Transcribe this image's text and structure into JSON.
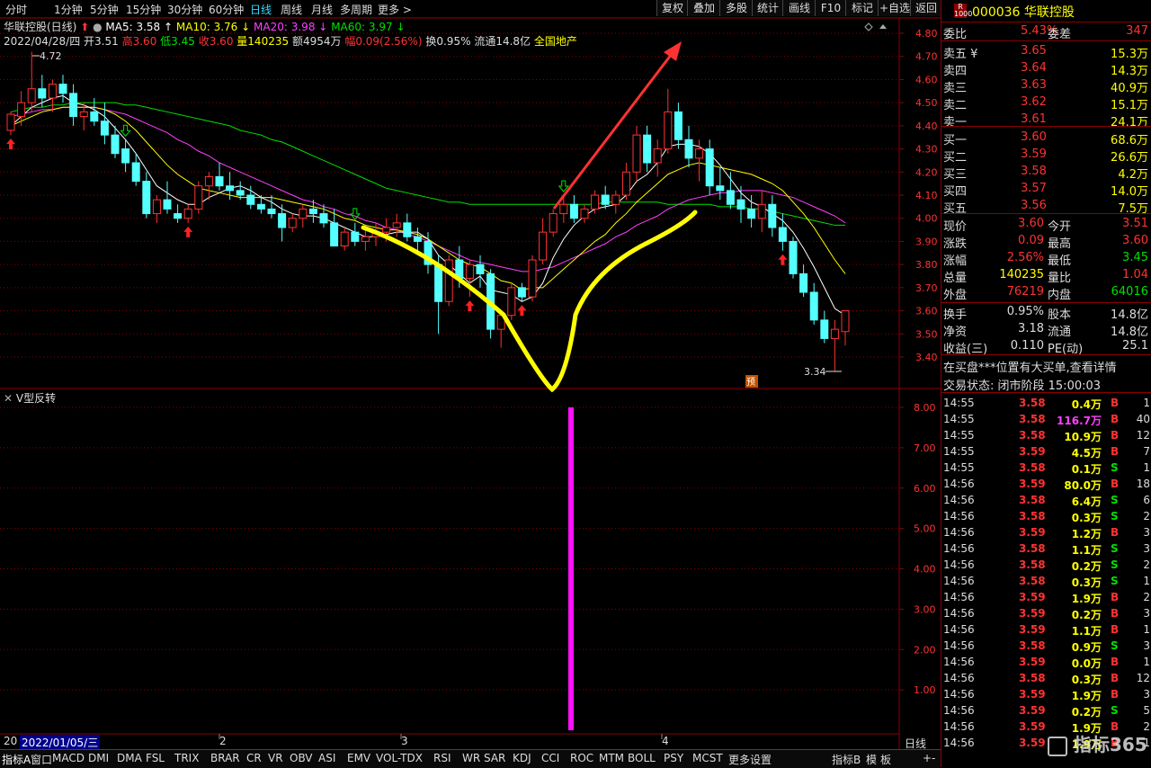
{
  "period_tabs": [
    "分时",
    "1分钟",
    "5分钟",
    "15分钟",
    "30分钟",
    "60分钟",
    "日线",
    "周线",
    "月线",
    "多周期",
    "更多 >"
  ],
  "active_tab": "日线",
  "toolbar_buttons": [
    "复权",
    "叠加",
    "多股",
    "统计",
    "画线",
    "F10",
    "标记",
    "+自选",
    "返回"
  ],
  "chart_header": {
    "name": "华联控股(日线)",
    "ma5": "MA5: 3.58",
    "ma10": "MA10: 3.76",
    "ma20": "MA20: 3.98",
    "ma60": "MA60: 3.97",
    "date": "2022/04/28/四",
    "open": "开3.51",
    "high": "高3.60",
    "low": "低3.45",
    "close": "收3.60",
    "volume": "量140235",
    "amount": "额4954万",
    "change": "幅0.09(2.56%)",
    "turnover": "换0.95%",
    "float": "流通14.8亿",
    "sector": "全国地产"
  },
  "price_axis": [
    "4.80",
    "4.70",
    "4.60",
    "4.50",
    "4.40",
    "4.30",
    "4.20",
    "4.10",
    "4.00",
    "3.90",
    "3.80",
    "3.70",
    "3.60",
    "3.50",
    "3.40"
  ],
  "price_high_label": "4.72",
  "price_low_label": "3.34",
  "yu_badge": "预",
  "indicator_title": "V型反转",
  "indicator_axis": [
    "8.00",
    "7.00",
    "6.00",
    "5.00",
    "4.00",
    "3.00",
    "2.00",
    "1.00"
  ],
  "x_axis": {
    "start": "20",
    "date_selected": "2022/01/05/三",
    "m2": "2",
    "m3": "3",
    "m4": "4"
  },
  "bottom_tabs": [
    "指标A",
    "窗口",
    "MACD",
    "DMI",
    "DMA",
    "FSL",
    "TRIX",
    "BRAR",
    "CR",
    "VR",
    "OBV",
    "ASI",
    "EMV",
    "VOL-TDX",
    "RSI",
    "WR",
    "SAR",
    "KDJ",
    "CCI",
    "ROC",
    "MTM",
    "BOLL",
    "PSY",
    "MCST",
    "更多",
    "设置"
  ],
  "bottom_right": [
    "指标B",
    "模",
    "板",
    "日线",
    "+",
    "-"
  ],
  "colors": {
    "up": "#ff3232",
    "down": "#54ffff",
    "ma5": "#ffffff",
    "ma10": "#ffff00",
    "ma20": "#ff40ff",
    "ma60": "#00e000",
    "grid": "#8b0000"
  },
  "chart_data": {
    "type": "candlestick",
    "ylim": [
      3.34,
      4.8
    ],
    "ohlc": [
      [
        4.38,
        4.46,
        4.36,
        4.45
      ],
      [
        4.44,
        4.55,
        4.4,
        4.5
      ],
      [
        4.5,
        4.72,
        4.46,
        4.56
      ],
      [
        4.56,
        4.62,
        4.48,
        4.52
      ],
      [
        4.52,
        4.6,
        4.46,
        4.58
      ],
      [
        4.58,
        4.62,
        4.5,
        4.54
      ],
      [
        4.54,
        4.58,
        4.4,
        4.44
      ],
      [
        4.44,
        4.5,
        4.38,
        4.46
      ],
      [
        4.46,
        4.52,
        4.4,
        4.42
      ],
      [
        4.42,
        4.5,
        4.32,
        4.36
      ],
      [
        4.36,
        4.4,
        4.26,
        4.28
      ],
      [
        4.3,
        4.34,
        4.2,
        4.24
      ],
      [
        4.24,
        4.28,
        4.14,
        4.16
      ],
      [
        4.16,
        4.2,
        4.0,
        4.02
      ],
      [
        4.02,
        4.1,
        3.98,
        4.08
      ],
      [
        4.08,
        4.16,
        4.02,
        4.04
      ],
      [
        4.02,
        4.06,
        3.98,
        4.0
      ],
      [
        4.0,
        4.06,
        3.98,
        4.04
      ],
      [
        4.04,
        4.16,
        4.02,
        4.14
      ],
      [
        4.14,
        4.2,
        4.08,
        4.18
      ],
      [
        4.18,
        4.24,
        4.12,
        4.14
      ],
      [
        4.14,
        4.2,
        4.08,
        4.12
      ],
      [
        4.12,
        4.16,
        4.08,
        4.1
      ],
      [
        4.1,
        4.14,
        4.04,
        4.06
      ],
      [
        4.06,
        4.1,
        4.02,
        4.04
      ],
      [
        4.04,
        4.1,
        4.0,
        4.02
      ],
      [
        4.02,
        4.06,
        3.9,
        3.96
      ],
      [
        3.96,
        4.02,
        3.94,
        4.0
      ],
      [
        4.0,
        4.06,
        3.96,
        4.04
      ],
      [
        4.04,
        4.08,
        3.98,
        4.02
      ],
      [
        4.02,
        4.06,
        3.96,
        3.98
      ],
      [
        3.98,
        4.04,
        3.92,
        3.88
      ],
      [
        3.88,
        3.96,
        3.86,
        3.94
      ],
      [
        3.94,
        3.98,
        3.88,
        3.9
      ],
      [
        3.9,
        3.96,
        3.86,
        3.92
      ],
      [
        3.92,
        3.98,
        3.88,
        3.94
      ],
      [
        3.94,
        4.0,
        3.9,
        3.96
      ],
      [
        3.96,
        4.02,
        3.92,
        3.98
      ],
      [
        3.98,
        4.02,
        3.9,
        3.92
      ],
      [
        3.92,
        3.96,
        3.86,
        3.9
      ],
      [
        3.9,
        3.94,
        3.76,
        3.8
      ],
      [
        3.8,
        3.84,
        3.5,
        3.64
      ],
      [
        3.64,
        3.84,
        3.62,
        3.82
      ],
      [
        3.82,
        3.88,
        3.7,
        3.74
      ],
      [
        3.74,
        3.82,
        3.66,
        3.8
      ],
      [
        3.8,
        3.84,
        3.7,
        3.76
      ],
      [
        3.76,
        3.78,
        3.48,
        3.52
      ],
      [
        3.52,
        3.6,
        3.44,
        3.58
      ],
      [
        3.58,
        3.72,
        3.56,
        3.7
      ],
      [
        3.7,
        3.72,
        3.64,
        3.66
      ],
      [
        3.66,
        3.84,
        3.64,
        3.82
      ],
      [
        3.82,
        4.0,
        3.8,
        3.94
      ],
      [
        3.94,
        4.04,
        3.92,
        4.02
      ],
      [
        4.02,
        4.1,
        3.98,
        4.06
      ],
      [
        4.06,
        4.1,
        3.98,
        4.0
      ],
      [
        4.0,
        4.06,
        3.98,
        4.04
      ],
      [
        4.04,
        4.12,
        4.02,
        4.1
      ],
      [
        4.1,
        4.14,
        4.04,
        4.06
      ],
      [
        4.06,
        4.12,
        4.02,
        4.1
      ],
      [
        4.1,
        4.24,
        4.08,
        4.2
      ],
      [
        4.2,
        4.4,
        4.16,
        4.36
      ],
      [
        4.36,
        4.4,
        4.2,
        4.24
      ],
      [
        4.24,
        4.34,
        4.18,
        4.3
      ],
      [
        4.3,
        4.56,
        4.28,
        4.46
      ],
      [
        4.46,
        4.5,
        4.3,
        4.34
      ],
      [
        4.34,
        4.4,
        4.22,
        4.26
      ],
      [
        4.26,
        4.34,
        4.16,
        4.3
      ],
      [
        4.3,
        4.34,
        4.1,
        4.14
      ],
      [
        4.14,
        4.22,
        4.08,
        4.12
      ],
      [
        4.12,
        4.2,
        4.04,
        4.06
      ],
      [
        4.08,
        4.14,
        3.98,
        4.04
      ],
      [
        4.04,
        4.1,
        3.96,
        4.0
      ],
      [
        4.0,
        4.12,
        3.94,
        4.06
      ],
      [
        4.06,
        4.1,
        3.92,
        3.96
      ],
      [
        3.96,
        4.02,
        3.86,
        3.9
      ],
      [
        3.9,
        3.92,
        3.74,
        3.76
      ],
      [
        3.76,
        3.8,
        3.66,
        3.68
      ],
      [
        3.68,
        3.72,
        3.54,
        3.56
      ],
      [
        3.56,
        3.6,
        3.46,
        3.48
      ],
      [
        3.48,
        3.56,
        3.34,
        3.52
      ],
      [
        3.51,
        3.6,
        3.45,
        3.6
      ]
    ],
    "ma5": [
      4.4,
      4.44,
      4.48,
      4.5,
      4.52,
      4.53,
      4.5,
      4.49,
      4.47,
      4.44,
      4.39,
      4.34,
      4.28,
      4.21,
      4.14,
      4.11,
      4.08,
      4.06,
      4.06,
      4.09,
      4.11,
      4.13,
      4.14,
      4.12,
      4.09,
      4.07,
      4.04,
      4.02,
      4.01,
      4.01,
      4.0,
      3.98,
      3.96,
      3.94,
      3.92,
      3.92,
      3.93,
      3.94,
      3.94,
      3.94,
      3.91,
      3.84,
      3.8,
      3.76,
      3.72,
      3.75,
      3.69,
      3.68,
      3.67,
      3.64,
      3.66,
      3.72,
      3.83,
      3.91,
      3.97,
      4.01,
      4.04,
      4.05,
      4.06,
      4.1,
      4.16,
      4.19,
      4.24,
      4.31,
      4.32,
      4.32,
      4.31,
      4.28,
      4.23,
      4.17,
      4.11,
      4.07,
      4.05,
      4.02,
      3.99,
      3.94,
      3.87,
      3.79,
      3.7,
      3.61,
      3.58
    ],
    "ma10": [
      4.4,
      4.42,
      4.44,
      4.46,
      4.47,
      4.48,
      4.48,
      4.48,
      4.48,
      4.47,
      4.45,
      4.42,
      4.38,
      4.33,
      4.28,
      4.23,
      4.19,
      4.16,
      4.13,
      4.12,
      4.11,
      4.1,
      4.09,
      4.09,
      4.09,
      4.09,
      4.08,
      4.07,
      4.06,
      4.05,
      4.04,
      4.02,
      4.0,
      3.99,
      3.97,
      3.96,
      3.95,
      3.95,
      3.94,
      3.93,
      3.91,
      3.88,
      3.85,
      3.82,
      3.8,
      3.79,
      3.76,
      3.73,
      3.72,
      3.69,
      3.7,
      3.7,
      3.74,
      3.78,
      3.82,
      3.86,
      3.9,
      3.93,
      3.98,
      4.02,
      4.07,
      4.11,
      4.15,
      4.19,
      4.21,
      4.23,
      4.24,
      4.23,
      4.22,
      4.21,
      4.2,
      4.19,
      4.17,
      4.15,
      4.12,
      4.07,
      4.02,
      3.96,
      3.89,
      3.82,
      3.76
    ],
    "ma20": [
      4.44,
      4.45,
      4.46,
      4.47,
      4.47,
      4.48,
      4.48,
      4.48,
      4.48,
      4.47,
      4.46,
      4.45,
      4.43,
      4.41,
      4.39,
      4.37,
      4.34,
      4.32,
      4.29,
      4.27,
      4.24,
      4.22,
      4.2,
      4.18,
      4.16,
      4.14,
      4.12,
      4.1,
      4.08,
      4.07,
      4.05,
      4.04,
      4.02,
      4.01,
      3.99,
      3.98,
      3.96,
      3.95,
      3.93,
      3.92,
      3.9,
      3.88,
      3.86,
      3.84,
      3.82,
      3.81,
      3.8,
      3.79,
      3.78,
      3.77,
      3.77,
      3.78,
      3.79,
      3.81,
      3.83,
      3.85,
      3.87,
      3.89,
      3.92,
      3.94,
      3.97,
      3.99,
      4.01,
      4.04,
      4.06,
      4.08,
      4.09,
      4.1,
      4.11,
      4.11,
      4.12,
      4.12,
      4.12,
      4.11,
      4.1,
      4.09,
      4.07,
      4.05,
      4.03,
      4.01,
      3.98
    ],
    "ma60": [
      4.46,
      4.47,
      4.48,
      4.48,
      4.49,
      4.49,
      4.5,
      4.5,
      4.5,
      4.5,
      4.5,
      4.49,
      4.49,
      4.48,
      4.47,
      4.46,
      4.45,
      4.44,
      4.43,
      4.42,
      4.41,
      4.4,
      4.38,
      4.37,
      4.36,
      4.34,
      4.33,
      4.31,
      4.29,
      4.27,
      4.25,
      4.23,
      4.21,
      4.19,
      4.17,
      4.15,
      4.13,
      4.12,
      4.11,
      4.1,
      4.09,
      4.08,
      4.07,
      4.07,
      4.06,
      4.06,
      4.06,
      4.06,
      4.06,
      4.06,
      4.06,
      4.06,
      4.06,
      4.06,
      4.06,
      4.06,
      4.06,
      4.07,
      4.07,
      4.07,
      4.07,
      4.07,
      4.07,
      4.06,
      4.06,
      4.06,
      4.06,
      4.06,
      4.05,
      4.05,
      4.05,
      4.04,
      4.04,
      4.03,
      4.02,
      4.01,
      4.0,
      3.99,
      3.98,
      3.97,
      3.97
    ],
    "buy_arrows": [
      0,
      17,
      44,
      49,
      74
    ],
    "sell_arrows": [
      11,
      33,
      53
    ],
    "indicator_signal": {
      "index": 50,
      "value": 8.0
    },
    "indicator_ylim": [
      0,
      8.5
    ]
  },
  "stock": {
    "code": "000036",
    "name": "华联控股",
    "badge": "R"
  },
  "ratio": {
    "label1": "委比",
    "value1": "5.43%",
    "label2": "委差",
    "value2": "347"
  },
  "asks": [
    {
      "label": "卖五 ¥",
      "price": "3.65",
      "vol": "15.3万"
    },
    {
      "label": "卖四",
      "price": "3.64",
      "vol": "14.3万"
    },
    {
      "label": "卖三",
      "price": "3.63",
      "vol": "40.9万"
    },
    {
      "label": "卖二",
      "price": "3.62",
      "vol": "15.1万"
    },
    {
      "label": "卖一",
      "price": "3.61",
      "vol": "24.1万"
    }
  ],
  "bids": [
    {
      "label": "买一",
      "price": "3.60",
      "vol": "68.6万"
    },
    {
      "label": "买二",
      "price": "3.59",
      "vol": "26.6万"
    },
    {
      "label": "买三",
      "price": "3.58",
      "vol": "4.2万"
    },
    {
      "label": "买四",
      "price": "3.57",
      "vol": "14.0万"
    },
    {
      "label": "买五",
      "price": "3.56",
      "vol": "7.5万"
    }
  ],
  "stats": [
    {
      "l1": "现价",
      "v1": "3.60",
      "l2": "今开",
      "v2": "3.51",
      "c1": "#ff3232",
      "c2": "#ff3232"
    },
    {
      "l1": "涨跌",
      "v1": "0.09",
      "l2": "最高",
      "v2": "3.60",
      "c1": "#ff3232",
      "c2": "#ff3232"
    },
    {
      "l1": "涨幅",
      "v1": "2.56%",
      "l2": "最低",
      "v2": "3.45",
      "c1": "#ff3232",
      "c2": "#00e000"
    },
    {
      "l1": "总量",
      "v1": "140235",
      "l2": "量比",
      "v2": "1.04",
      "c1": "#ffff00",
      "c2": "#ff3232"
    },
    {
      "l1": "外盘",
      "v1": "76219",
      "l2": "内盘",
      "v2": "64016",
      "c1": "#ff3232",
      "c2": "#00e000"
    }
  ],
  "fund": [
    {
      "l1": "换手",
      "v1": "0.95%",
      "l2": "股本",
      "v2": "14.8亿"
    },
    {
      "l1": "净资",
      "v1": "3.18",
      "l2": "流通",
      "v2": "14.8亿"
    },
    {
      "l1": "收益(三)",
      "v1": "0.110",
      "l2": "PE(动)",
      "v2": "25.1"
    }
  ],
  "notice": "在买盘***位置有大买单,查看详情",
  "trade_status": "交易状态: 闭市阶段 15:00:03",
  "ticks": [
    {
      "t": "14:55",
      "p": "3.58",
      "v": "0.4万",
      "s": "B",
      "n": "1"
    },
    {
      "t": "14:55",
      "p": "3.58",
      "v": "116.7万",
      "s": "B",
      "n": "40"
    },
    {
      "t": "14:55",
      "p": "3.58",
      "v": "10.9万",
      "s": "B",
      "n": "12"
    },
    {
      "t": "14:55",
      "p": "3.59",
      "v": "4.5万",
      "s": "B",
      "n": "7"
    },
    {
      "t": "14:55",
      "p": "3.58",
      "v": "0.1万",
      "s": "S",
      "n": "1"
    },
    {
      "t": "14:56",
      "p": "3.59",
      "v": "80.0万",
      "s": "B",
      "n": "18"
    },
    {
      "t": "14:56",
      "p": "3.58",
      "v": "6.4万",
      "s": "S",
      "n": "6"
    },
    {
      "t": "14:56",
      "p": "3.58",
      "v": "0.3万",
      "s": "S",
      "n": "2"
    },
    {
      "t": "14:56",
      "p": "3.59",
      "v": "1.2万",
      "s": "B",
      "n": "3"
    },
    {
      "t": "14:56",
      "p": "3.58",
      "v": "1.1万",
      "s": "S",
      "n": "3"
    },
    {
      "t": "14:56",
      "p": "3.58",
      "v": "0.2万",
      "s": "S",
      "n": "2"
    },
    {
      "t": "14:56",
      "p": "3.58",
      "v": "0.3万",
      "s": "S",
      "n": "1"
    },
    {
      "t": "14:56",
      "p": "3.59",
      "v": "1.9万",
      "s": "B",
      "n": "2"
    },
    {
      "t": "14:56",
      "p": "3.59",
      "v": "0.2万",
      "s": "B",
      "n": "3"
    },
    {
      "t": "14:56",
      "p": "3.59",
      "v": "1.1万",
      "s": "B",
      "n": "1"
    },
    {
      "t": "14:56",
      "p": "3.58",
      "v": "0.9万",
      "s": "S",
      "n": "3"
    },
    {
      "t": "14:56",
      "p": "3.59",
      "v": "0.0万",
      "s": "B",
      "n": "1"
    },
    {
      "t": "14:56",
      "p": "3.58",
      "v": "0.3万",
      "s": "B",
      "n": "12"
    },
    {
      "t": "14:56",
      "p": "3.59",
      "v": "1.9万",
      "s": "B",
      "n": "3"
    },
    {
      "t": "14:56",
      "p": "3.59",
      "v": "0.2万",
      "s": "S",
      "n": "5"
    },
    {
      "t": "14:56",
      "p": "3.59",
      "v": "1.9万",
      "s": "B",
      "n": "2"
    },
    {
      "t": "14:56",
      "p": "3.59",
      "v": "1.9万",
      "s": "B",
      "n": "1"
    }
  ],
  "watermark": "指标365"
}
